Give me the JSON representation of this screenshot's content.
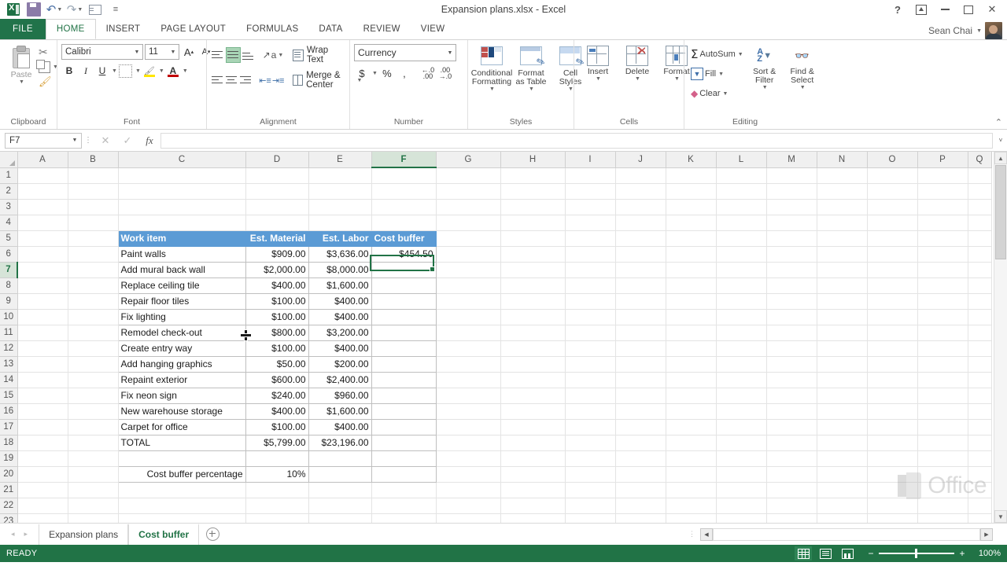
{
  "titlebar": {
    "document_title": "Expansion plans.xlsx - Excel",
    "qat": [
      {
        "name": "excel-logo",
        "label": "X"
      },
      {
        "name": "save-icon",
        "label": "Save"
      },
      {
        "name": "undo-icon",
        "label": "Undo"
      },
      {
        "name": "redo-icon",
        "label": "Redo"
      },
      {
        "name": "touch-mode-icon",
        "label": "Touch/Mouse Mode"
      },
      {
        "name": "customize-qat-icon",
        "label": "Customize Quick Access Toolbar"
      }
    ],
    "help": "?",
    "ribbon_display": "Ribbon Display Options",
    "minimize": "Minimize",
    "maximize": "Maximize",
    "close": "✕"
  },
  "tabs": {
    "file": "FILE",
    "items": [
      "HOME",
      "INSERT",
      "PAGE LAYOUT",
      "FORMULAS",
      "DATA",
      "REVIEW",
      "VIEW"
    ],
    "active": "HOME"
  },
  "account": {
    "user_name": "Sean Chai",
    "caret": "▾"
  },
  "ribbon": {
    "groups": [
      {
        "name": "Clipboard",
        "label": "Clipboard",
        "paste_label": "Paste",
        "cut_label": "Cut",
        "copy_label": "Copy",
        "format_painter_label": "Format Painter"
      },
      {
        "name": "Font",
        "label": "Font",
        "font_family": "Calibri",
        "font_size": "11",
        "grow_font": "A",
        "shrink_font": "A",
        "bold": "B",
        "italic": "I",
        "underline": "U",
        "borders": "Borders",
        "fill_color": "Fill Color",
        "font_color": "A"
      },
      {
        "name": "Alignment",
        "label": "Alignment",
        "wrap_text": "Wrap Text",
        "merge_center": "Merge & Center",
        "orientation": "Orientation",
        "decrease_indent": "Decrease Indent",
        "increase_indent": "Increase Indent"
      },
      {
        "name": "Number",
        "label": "Number",
        "format": "Currency",
        "accounting": "$",
        "percent": "%",
        "comma": ",",
        "decrease_decimal": "Decrease Decimal",
        "increase_decimal": "Increase Decimal"
      },
      {
        "name": "Styles",
        "label": "Styles",
        "items": [
          "Conditional Formatting",
          "Format as Table",
          "Cell Styles"
        ]
      },
      {
        "name": "Cells",
        "label": "Cells",
        "items": [
          "Insert",
          "Delete",
          "Format"
        ]
      },
      {
        "name": "Editing",
        "label": "Editing",
        "autosum": "AutoSum",
        "fill": "Fill",
        "clear": "Clear",
        "sort_filter": "Sort & Filter",
        "find_select": "Find & Select"
      }
    ],
    "collapse": "⌃"
  },
  "formula_bar": {
    "name_box": "F7",
    "cancel": "✕",
    "enter": "✓",
    "fx": "fx",
    "value": "",
    "expand": "˅"
  },
  "grid": {
    "columns": [
      "A",
      "B",
      "C",
      "D",
      "E",
      "F",
      "G",
      "H",
      "I",
      "J",
      "K",
      "L",
      "M",
      "N",
      "O",
      "P",
      "Q"
    ],
    "selected_column": "F",
    "selected_row": 7,
    "active_cell": "F7",
    "rows": [
      1,
      2,
      3,
      4,
      5,
      6,
      7,
      8,
      9,
      10,
      11,
      12,
      13,
      14,
      15,
      16,
      17,
      18,
      19,
      20,
      21,
      22,
      23
    ],
    "table": {
      "header_row": 5,
      "headers": [
        "Work item",
        "Est. Material",
        "Est. Labor",
        "Cost buffer"
      ],
      "data": [
        {
          "row": 6,
          "work_item": "Paint walls",
          "material": "$909.00",
          "labor": "$3,636.00",
          "buffer": "$454.50"
        },
        {
          "row": 7,
          "work_item": "Add mural back wall",
          "material": "$2,000.00",
          "labor": "$8,000.00",
          "buffer": ""
        },
        {
          "row": 8,
          "work_item": "Replace ceiling tile",
          "material": "$400.00",
          "labor": "$1,600.00",
          "buffer": ""
        },
        {
          "row": 9,
          "work_item": "Repair floor tiles",
          "material": "$100.00",
          "labor": "$400.00",
          "buffer": ""
        },
        {
          "row": 10,
          "work_item": "Fix lighting",
          "material": "$100.00",
          "labor": "$400.00",
          "buffer": ""
        },
        {
          "row": 11,
          "work_item": "Remodel check-out",
          "material": "$800.00",
          "labor": "$3,200.00",
          "buffer": ""
        },
        {
          "row": 12,
          "work_item": "Create entry way",
          "material": "$100.00",
          "labor": "$400.00",
          "buffer": ""
        },
        {
          "row": 13,
          "work_item": "Add hanging graphics",
          "material": "$50.00",
          "labor": "$200.00",
          "buffer": ""
        },
        {
          "row": 14,
          "work_item": "Repaint exterior",
          "material": "$600.00",
          "labor": "$2,400.00",
          "buffer": ""
        },
        {
          "row": 15,
          "work_item": "Fix neon sign",
          "material": "$240.00",
          "labor": "$960.00",
          "buffer": ""
        },
        {
          "row": 16,
          "work_item": "New warehouse storage",
          "material": "$400.00",
          "labor": "$1,600.00",
          "buffer": ""
        },
        {
          "row": 17,
          "work_item": "Carpet for office",
          "material": "$100.00",
          "labor": "$400.00",
          "buffer": ""
        },
        {
          "row": 18,
          "work_item": "TOTAL",
          "material": "$5,799.00",
          "labor": "$23,196.00",
          "buffer": ""
        }
      ],
      "footer": {
        "row": 20,
        "label": "Cost buffer percentage",
        "value": "10%"
      }
    },
    "watermark": "Office"
  },
  "sheet_tabs": {
    "items": [
      {
        "label": "Expansion plans",
        "active": false
      },
      {
        "label": "Cost buffer",
        "active": true
      }
    ],
    "add_sheet": "New sheet",
    "prev": "◂",
    "next": "▸"
  },
  "status_bar": {
    "mode": "READY",
    "views": [
      "Normal",
      "Page Layout",
      "Page Break Preview"
    ],
    "active_view": "Normal",
    "zoom_out": "−",
    "zoom_in": "+",
    "zoom": "100%"
  }
}
